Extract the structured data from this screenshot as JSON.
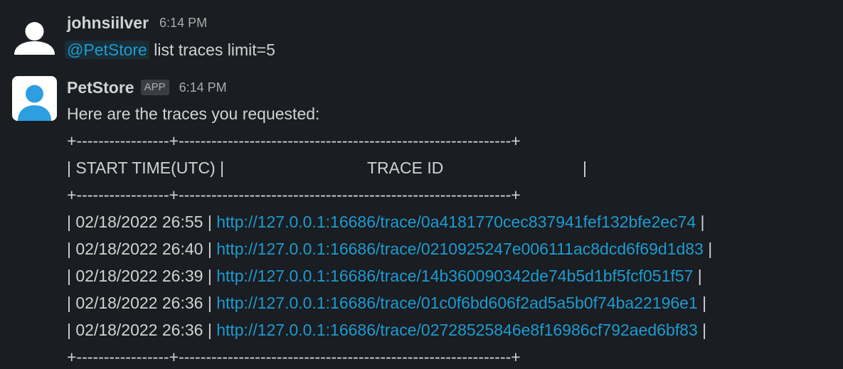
{
  "messages": [
    {
      "author": "johnsiilver",
      "time": "6:14 PM",
      "mention": "@PetStore",
      "text": "list traces limit=5"
    },
    {
      "author": "PetStore",
      "badge": "APP",
      "time": "6:14 PM",
      "intro": "Here are the traces you requested:",
      "table": {
        "border": "+-----------------+-------------------------------------------------------------+",
        "header_start": "| START TIME(UTC)  |",
        "header_trace": "TRACE ID",
        "header_end": "|",
        "rows": [
          {
            "time": "| 02/18/2022 26:55 |",
            "url": "http://127.0.0.1:16686/trace/0a4181770cec837941fef132bfe2ec74",
            "end": "|"
          },
          {
            "time": "| 02/18/2022 26:40 |",
            "url": "http://127.0.0.1:16686/trace/0210925247e006111ac8dcd6f69d1d83",
            "end": "|"
          },
          {
            "time": "| 02/18/2022 26:39 |",
            "url": "http://127.0.0.1:16686/trace/14b360090342de74b5d1bf5fcf051f57",
            "end": "|"
          },
          {
            "time": "| 02/18/2022 26:36 |",
            "url": "http://127.0.0.1:16686/trace/01c0f6bd606f2ad5a5b0f74ba22196e1",
            "end": "|"
          },
          {
            "time": "| 02/18/2022 26:36 |",
            "url": "http://127.0.0.1:16686/trace/02728525846e8f16986cf792aed6bf83",
            "end": "|"
          }
        ]
      }
    }
  ],
  "colors": {
    "background": "#1a1d21",
    "link": "#1d9bd1",
    "text": "#d1d2d3",
    "muted": "#a9abad",
    "bot_avatar_bg": "#2d9ee0"
  },
  "icons": {
    "user_avatar": "user-silhouette-icon",
    "bot_avatar": "user-silhouette-icon"
  }
}
